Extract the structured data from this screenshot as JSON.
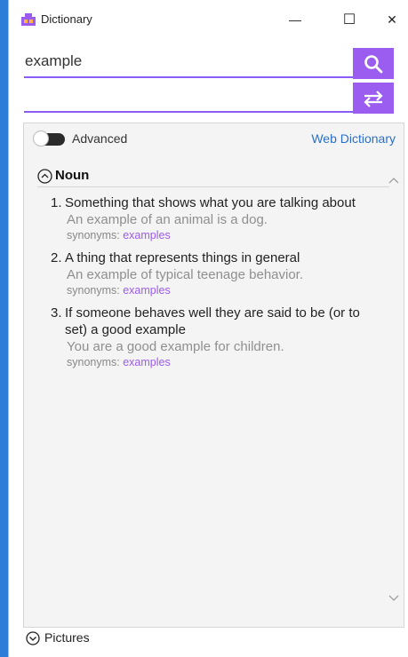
{
  "window": {
    "title": "Dictionary",
    "minimize_glyph": "—",
    "maximize_glyph": "☐",
    "close_glyph": "✕"
  },
  "search": {
    "value": "example",
    "icon": "search-icon"
  },
  "swap": {
    "icon": "swap-icon"
  },
  "panel": {
    "advanced_label": "Advanced",
    "advanced_on": false,
    "web_dictionary_link": "Web Dictionary",
    "section_title": "Noun",
    "definitions": [
      {
        "num": "1.",
        "text": "Something that shows what you are talking about",
        "example": "An example of an animal is a dog.",
        "synonyms_label": "synonyms: ",
        "synonym": "examples"
      },
      {
        "num": "2.",
        "text": "A thing that represents things in general",
        "example": "An example of typical teenage behavior.",
        "synonyms_label": "synonyms: ",
        "synonym": "examples"
      },
      {
        "num": "3.",
        "text": "If someone behaves well they are said to be (or to set) a good example",
        "example": "You are a good example for children.",
        "synonyms_label": "synonyms: ",
        "synonym": "examples"
      }
    ],
    "pictures_label": "Pictures"
  },
  "colors": {
    "accent": "#9b5cf0",
    "link": "#2b6fc7",
    "desktop": "#2b7dd6"
  }
}
